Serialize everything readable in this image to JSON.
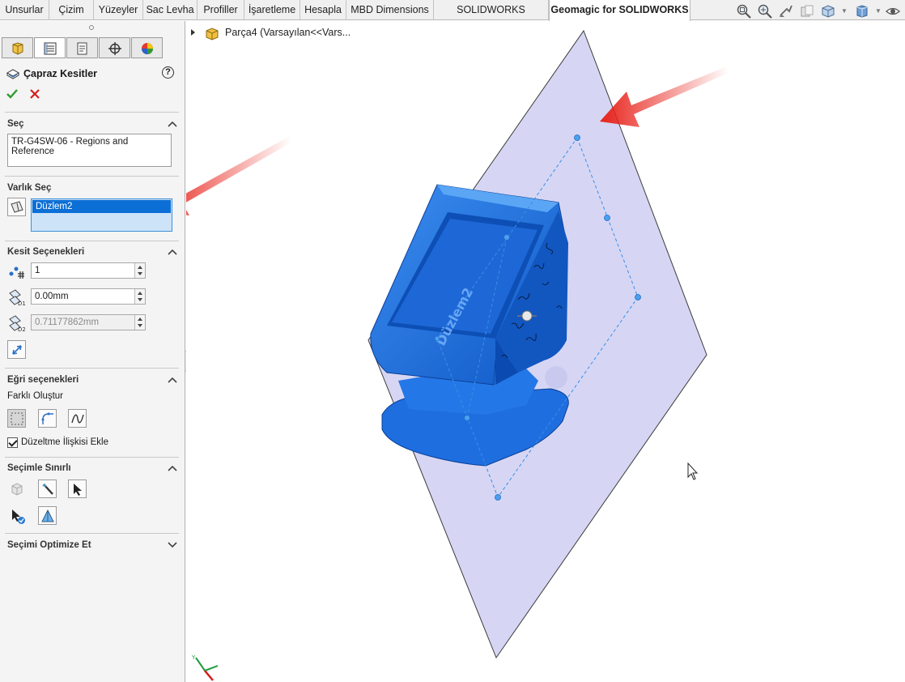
{
  "tabs": [
    "Unsurlar",
    "Çizim",
    "Yüzeyler",
    "Sac Levha",
    "Profiller",
    "İşaretleme",
    "Hesapla",
    "MBD Dimensions",
    "SOLIDWORKS Eklentileri",
    "Geomagic for SOLIDWORKS"
  ],
  "active_tab": "Geomagic for SOLIDWORKS",
  "heads_up_icons": [
    "zoom-to-fit-icon",
    "zoom-to-area-icon",
    "previous-view-icon",
    "section-view-icon",
    "view-orientation-icon",
    "display-style-icon",
    "hide-show-items-icon"
  ],
  "property_manager": {
    "tab_icons": [
      "feature-manager-icon",
      "property-manager-icon",
      "configuration-manager-icon",
      "dimxpert-icon",
      "display-manager-icon"
    ],
    "title": "Çapraz Kesitler",
    "help": "?",
    "sections": {
      "select": {
        "header": "Seç",
        "value": "TR-G4SW-06 - Regions and Reference"
      },
      "entity_select": {
        "header": "Varlık Seç",
        "selected_item": "Düzlem2"
      },
      "section_options": {
        "header": "Kesit Seçenekleri",
        "count": "1",
        "offset": "0.00mm",
        "step": "0.71177862mm"
      },
      "curve_options": {
        "header": "Eğri seçenekleri",
        "create_different": "Farklı Oluştur",
        "fit_relation_label": "Düzeltme İlişkisi Ekle",
        "fit_relation_checked": true
      },
      "selection_limit": {
        "header": "Seçimle Sınırlı"
      },
      "optimize": {
        "header": "Seçimi Optimize Et"
      }
    }
  },
  "feature_tree": {
    "part_label": "Parça4  (Varsayılan<<Vars..."
  },
  "viewport": {
    "plane_label": "Düzlem2",
    "part_color": "#1e6fe0",
    "plane_color": "#c8c8f0",
    "arrow_color": "#e8231b"
  }
}
